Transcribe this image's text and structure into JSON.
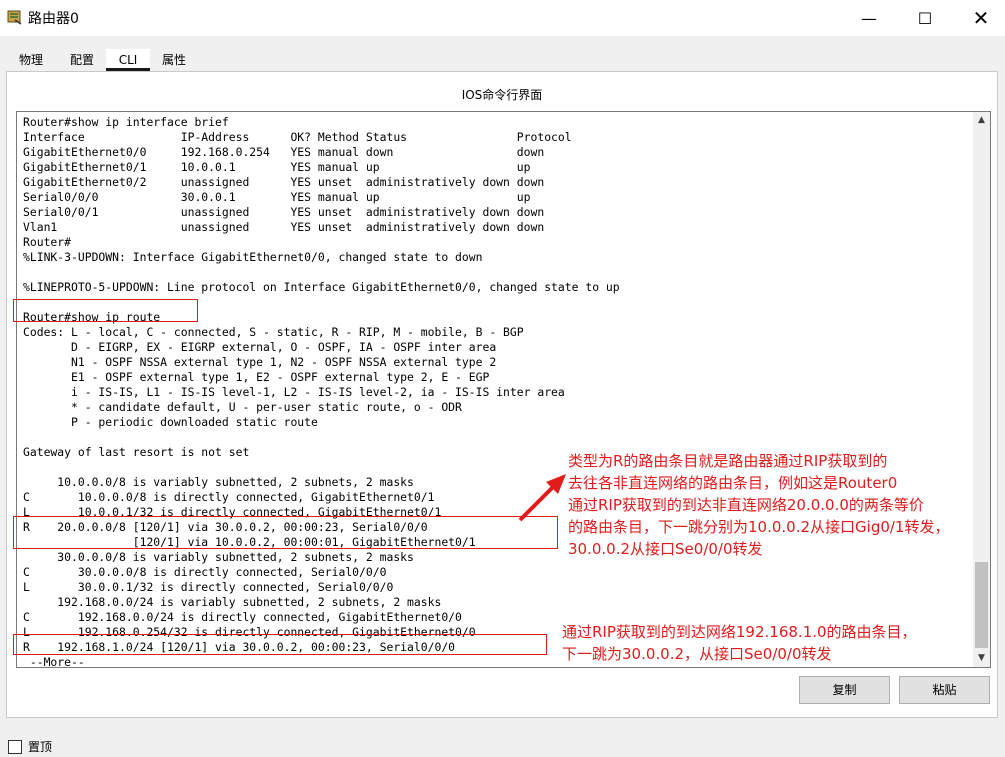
{
  "window": {
    "title": "路由器0",
    "minimize_glyph": "—",
    "maximize_glyph": "☐",
    "close_glyph": "✕",
    "icon": "router-icon"
  },
  "tabs": [
    {
      "label": "物理"
    },
    {
      "label": "配置"
    },
    {
      "label": "CLI",
      "active": true
    },
    {
      "label": "属性"
    }
  ],
  "cli": {
    "heading": "IOS命令行界面",
    "lines": [
      "Router#show ip interface brief",
      "Interface              IP-Address      OK? Method Status                Protocol",
      "GigabitEthernet0/0     192.168.0.254   YES manual down                  down",
      "GigabitEthernet0/1     10.0.0.1        YES manual up                    up",
      "GigabitEthernet0/2     unassigned      YES unset  administratively down down",
      "Serial0/0/0            30.0.0.1        YES manual up                    up",
      "Serial0/0/1            unassigned      YES unset  administratively down down",
      "Vlan1                  unassigned      YES unset  administratively down down",
      "Router#",
      "%LINK-3-UPDOWN: Interface GigabitEthernet0/0, changed state to down",
      "",
      "%LINEPROTO-5-UPDOWN: Line protocol on Interface GigabitEthernet0/0, changed state to up",
      "",
      "Router#show ip route",
      "Codes: L - local, C - connected, S - static, R - RIP, M - mobile, B - BGP",
      "       D - EIGRP, EX - EIGRP external, O - OSPF, IA - OSPF inter area",
      "       N1 - OSPF NSSA external type 1, N2 - OSPF NSSA external type 2",
      "       E1 - OSPF external type 1, E2 - OSPF external type 2, E - EGP",
      "       i - IS-IS, L1 - IS-IS level-1, L2 - IS-IS level-2, ia - IS-IS inter area",
      "       * - candidate default, U - per-user static route, o - ODR",
      "       P - periodic downloaded static route",
      "",
      "Gateway of last resort is not set",
      "",
      "     10.0.0.0/8 is variably subnetted, 2 subnets, 2 masks",
      "C       10.0.0.0/8 is directly connected, GigabitEthernet0/1",
      "L       10.0.0.1/32 is directly connected, GigabitEthernet0/1",
      "R    20.0.0.0/8 [120/1] via 30.0.0.2, 00:00:23, Serial0/0/0",
      "                [120/1] via 10.0.0.2, 00:00:01, GigabitEthernet0/1",
      "     30.0.0.0/8 is variably subnetted, 2 subnets, 2 masks",
      "C       30.0.0.0/8 is directly connected, Serial0/0/0",
      "L       30.0.0.1/32 is directly connected, Serial0/0/0",
      "     192.168.0.0/24 is variably subnetted, 2 subnets, 2 masks",
      "C       192.168.0.0/24 is directly connected, GigabitEthernet0/0",
      "L       192.168.0.254/32 is directly connected, GigabitEthernet0/0",
      "R    192.168.1.0/24 [120/1] via 30.0.0.2, 00:00:23, Serial0/0/0",
      " --More--"
    ]
  },
  "annotations": {
    "note1": "类型为R的路由条目就是路由器通过RIP获取到的\n去往各非直连网络的路由条目，例如这是Router0\n通过RIP获取到的到达非直连网络20.0.0.0的两条等价\n的路由条目，下一跳分别为10.0.0.2从接口Gig0/1转发，\n30.0.0.2从接口Se0/0/0转发",
    "note2": "通过RIP获取到的到达网络192.168.1.0的路由条目，\n下一跳为30.0.0.2，从接口Se0/0/0转发",
    "color": "#e21b1b"
  },
  "buttons": {
    "copy": "复制",
    "paste": "粘贴"
  },
  "pin": {
    "label": "置顶",
    "checked": false
  }
}
